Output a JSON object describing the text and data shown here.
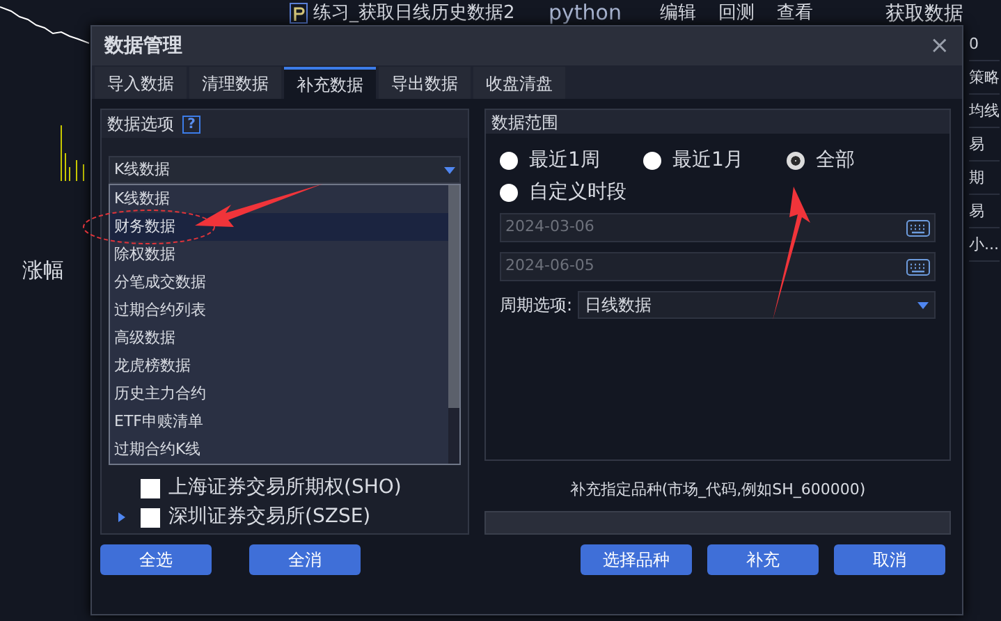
{
  "background": {
    "file_title": "练习_获取日线历史数据2",
    "language": "python",
    "menu": [
      "编辑",
      "回测",
      "查看"
    ],
    "fetch_button": "获取数据",
    "left_label": "涨幅",
    "right_column": [
      "0",
      "策略",
      "均线",
      "易",
      "期",
      "易",
      "小..."
    ]
  },
  "dialog": {
    "title": "数据管理",
    "close": "×",
    "tabs": [
      {
        "label": "导入数据",
        "selected": false
      },
      {
        "label": "清理数据",
        "selected": false
      },
      {
        "label": "补充数据",
        "selected": true
      },
      {
        "label": "导出数据",
        "selected": false
      },
      {
        "label": "收盘清盘",
        "selected": false
      }
    ],
    "options_panel": {
      "title": "数据选项",
      "help": "?",
      "select_value": "K线数据",
      "dropdown_items": [
        {
          "label": "K线数据",
          "selected": false
        },
        {
          "label": "财务数据",
          "selected": true
        },
        {
          "label": "除权数据",
          "selected": false
        },
        {
          "label": "分笔成交数据",
          "selected": false
        },
        {
          "label": "过期合约列表",
          "selected": false
        },
        {
          "label": "高级数据",
          "selected": false
        },
        {
          "label": "龙虎榜数据",
          "selected": false
        },
        {
          "label": "历史主力合约",
          "selected": false
        },
        {
          "label": "ETF申赎清单",
          "selected": false
        },
        {
          "label": "过期合约K线",
          "selected": false
        }
      ],
      "tree": [
        {
          "label": "上海证券交易所期权(SHO)",
          "checked": false,
          "expandable": false
        },
        {
          "label": "深圳证券交易所(SZSE)",
          "checked": false,
          "expandable": true
        }
      ]
    },
    "range_panel": {
      "title": "数据范围",
      "radios": [
        {
          "label": "最近1周",
          "selected": false
        },
        {
          "label": "最近1月",
          "selected": false
        },
        {
          "label": "全部",
          "selected": true
        },
        {
          "label": "自定义时段",
          "selected": false
        }
      ],
      "start_date": "2024-03-06",
      "end_date": "2024-06-05",
      "period_label": "周期选项:",
      "period_value": "日线数据"
    },
    "symbol_label": "补充指定品种(市场_代码,例如SH_600000)",
    "left_buttons": [
      "全选",
      "全消"
    ],
    "right_buttons": [
      "选择品种",
      "补充",
      "取消"
    ]
  }
}
